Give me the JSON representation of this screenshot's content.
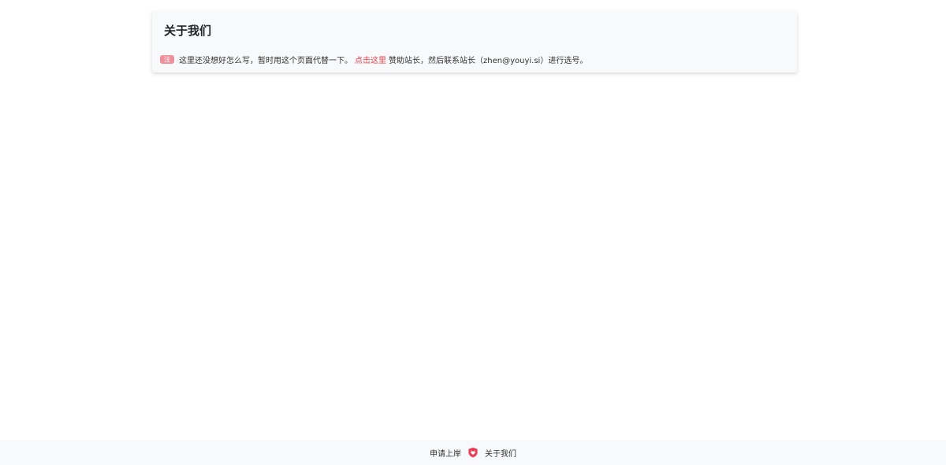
{
  "card": {
    "title": "关于我们",
    "badge": "注",
    "text_before": "这里还没想好怎么写，暂时用这个页面代替一下。",
    "link": "点击这里",
    "text_after": "赞助站长，然后联系站长（zhen@youyi.si）进行选号。"
  },
  "footer": {
    "link_apply": "申请上岸",
    "icon": "shield-heart-icon",
    "link_about": "关于我们"
  },
  "colors": {
    "accent": "#e0434f",
    "badge": "#f0909d",
    "card_bg": "#f8f9fa",
    "footer_bg": "#f8f9fa"
  }
}
